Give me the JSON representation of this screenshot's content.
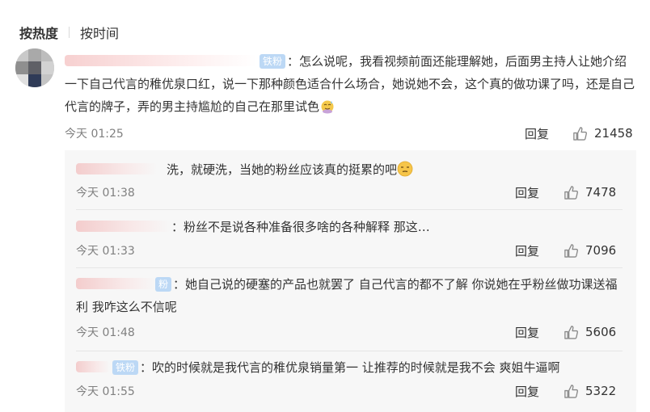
{
  "tabs": {
    "hot": "按热度",
    "time": "按时间"
  },
  "main_comment": {
    "badge": "铁粉",
    "text": "：怎么说呢，我看视频前面还能理解她，后面男主持人让她介绍一下自己代言的稚优泉口红，说一下那种颜色适合什么场合，她说她不会，这个真的做功课了吗，还是自己代言的牌子，弄的男主持尴尬的自己在那里试色",
    "emoji": "sweat-emoji",
    "time": "今天 01:25",
    "reply_label": "回复",
    "likes": "21458"
  },
  "replies": [
    {
      "badge": "",
      "text": "洗，就硬洗，当她的粉丝应该真的挺累的吧",
      "emoji": "smirk-emoji",
      "time": "今天 01:38",
      "reply_label": "回复",
      "likes": "7478"
    },
    {
      "badge": "",
      "text": "：粉丝不是说各种准备很多啥的各种解释  那这…",
      "emoji": "",
      "time": "今天 01:33",
      "reply_label": "回复",
      "likes": "7096"
    },
    {
      "badge": "粉",
      "text": "：她自己说的硬塞的产品也就罢了 自己代言的都不了解 你说她在乎粉丝做功课送福利 我咋这么不信呢",
      "emoji": "",
      "time": "今天 01:48",
      "reply_label": "回复",
      "likes": "5606"
    },
    {
      "badge": "铁粉",
      "text": "：吹的时候就是我代言的稚优泉销量第一  让推荐的时候就是我不会  爽姐牛逼啊",
      "emoji": "",
      "time": "今天 01:55",
      "reply_label": "回复",
      "likes": "5322"
    }
  ],
  "colors": {
    "badge_bg": "#bcd8f5",
    "meta_gray": "#808080",
    "sub_bg": "#f7f7f7"
  }
}
